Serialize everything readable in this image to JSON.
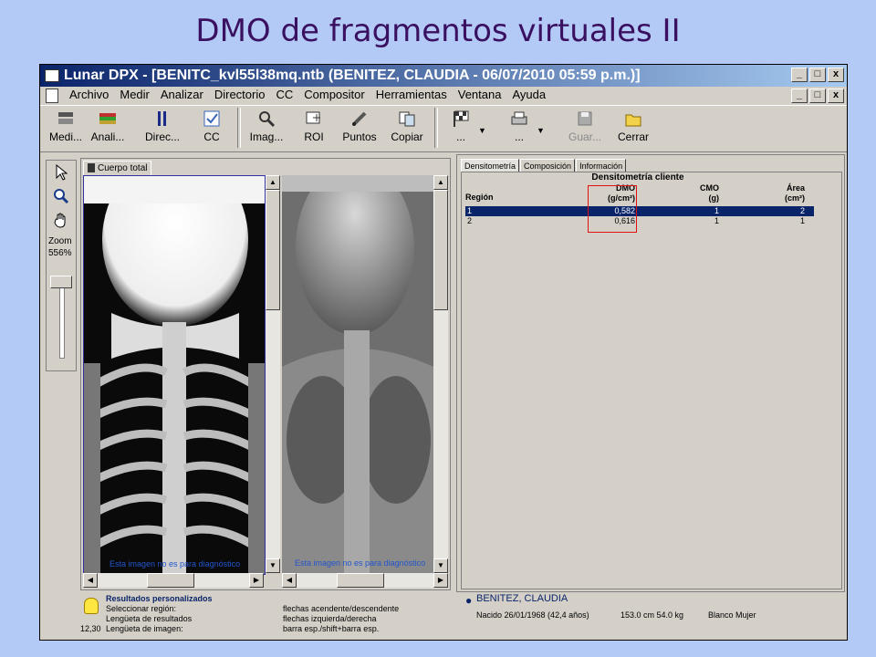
{
  "slide": {
    "title": "DMO de fragmentos virtuales II"
  },
  "window": {
    "title": "Lunar DPX - [BENITC_kvl55l38mq.ntb (BENITEZ, CLAUDIA - 06/07/2010 05:59 p.m.)]",
    "controls": [
      "_",
      "□",
      "x"
    ]
  },
  "menu": {
    "items": [
      "Archivo",
      "Medir",
      "Analizar",
      "Directorio",
      "CC",
      "Compositor",
      "Herramientas",
      "Ventana",
      "Ayuda"
    ]
  },
  "toolbar": {
    "buttons": [
      {
        "label": "Medi...",
        "icon": "measure-icon"
      },
      {
        "label": "Anali...",
        "icon": "analyze-icon"
      },
      {
        "label": "Direc...",
        "icon": "directory-icon"
      },
      {
        "label": "CC",
        "icon": "qc-check-icon"
      },
      {
        "label": "Imag...",
        "icon": "magnifier-icon"
      },
      {
        "label": "ROI",
        "icon": "roi-icon"
      },
      {
        "label": "Puntos",
        "icon": "points-brush-icon"
      },
      {
        "label": "Copiar",
        "icon": "copy-icon"
      },
      {
        "label": "...",
        "icon": "checkered-flag-icon"
      },
      {
        "label": "...",
        "icon": "printer-icon"
      },
      {
        "label": "Guar...",
        "icon": "save-icon"
      },
      {
        "label": "Cerrar",
        "icon": "close-folder-icon"
      }
    ]
  },
  "left_tools": {
    "zoom_label": "Zoom",
    "zoom_value": "556%"
  },
  "image_panel": {
    "tab": "Cuerpo total",
    "diagnostic_note_left": "Esta imagen no es para diagnóstico",
    "diagnostic_note_right": "Esta imagen no es para diagnóstico"
  },
  "data_panel": {
    "tabs": [
      "Densitometría",
      "Composición",
      "Información"
    ],
    "caption": "Densitometría cliente",
    "headers": {
      "region": "Región",
      "bmd": "DMO",
      "bmd_unit": "(g/cm²)",
      "bmc": "CMO",
      "bmc_unit": "(g)",
      "area": "Área",
      "area_unit": "(cm²)"
    },
    "rows": [
      {
        "region": "1",
        "bmd": "0,582",
        "bmc": "1",
        "area": "2",
        "selected": true
      },
      {
        "region": "2",
        "bmd": "0,616",
        "bmc": "1",
        "area": "1",
        "selected": false
      }
    ]
  },
  "status": {
    "heading": "Resultados personalizados",
    "lines_left": [
      {
        "key": "",
        "text": "Seleccionar región:"
      },
      {
        "key": "",
        "text": "Lengüeta de resultados"
      },
      {
        "key": "12,30",
        "text": "Lengüeta de imagen:"
      }
    ],
    "lines_mid": [
      "flechas acendente/descendente",
      "flechas izquierda/derecha",
      "barra esp./shift+barra esp."
    ],
    "patient_name": "BENITEZ, CLAUDIA",
    "patient_birth": "Nacido 26/01/1968 (42,4 años)",
    "patient_body": "153.0 cm 54.0 kg",
    "patient_group": "Blanco Mujer"
  },
  "colors": {
    "slide_bg": "#b3c9f6",
    "title": "#3a1060",
    "titlebar_start": "#0a246a",
    "selection": "#0a246a",
    "highlight_box": "#e01010"
  }
}
